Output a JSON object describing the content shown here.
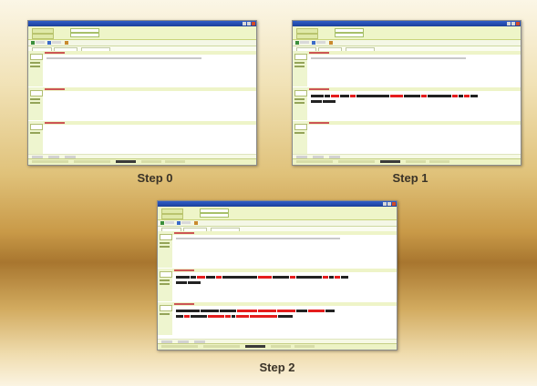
{
  "labels": {
    "step0": "Step 0",
    "step1": "Step 1",
    "step2": "Step 2"
  }
}
